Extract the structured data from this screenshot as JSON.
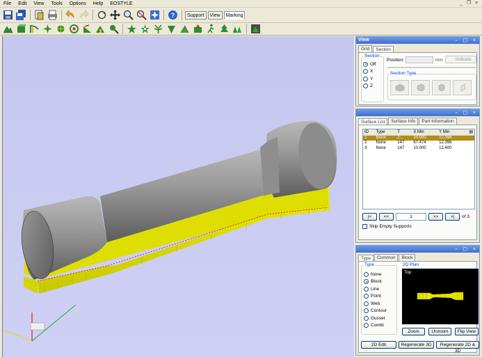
{
  "menu": [
    "File",
    "Edit",
    "View",
    "Tools",
    "Options",
    "Help",
    "EOSTYLE"
  ],
  "toolbar_tabs": [
    {
      "label": "Support",
      "active": false
    },
    {
      "label": "View",
      "active": false
    },
    {
      "label": "Marking",
      "active": true
    }
  ],
  "view_panel": {
    "title": "View",
    "tabs": [
      {
        "label": "Grid",
        "active": false
      },
      {
        "label": "Section",
        "active": true
      }
    ],
    "section_group_label": "Section",
    "section_options": [
      {
        "label": "Off",
        "checked": true
      },
      {
        "label": "X",
        "checked": false
      },
      {
        "label": "Y",
        "checked": false
      },
      {
        "label": "Z",
        "checked": false
      }
    ],
    "position_label": "Position:",
    "position_value": "",
    "unit": "mm",
    "indicate_label": "Indicate",
    "section_type_label": "Section Type"
  },
  "surface_panel": {
    "tabs": [
      {
        "label": "Surface List",
        "active": true
      },
      {
        "label": "Surface Info",
        "active": false
      },
      {
        "label": "Part Information",
        "active": false
      }
    ],
    "columns": [
      "ID",
      "Type",
      "T",
      "X Min",
      "Y Min"
    ],
    "rows": [
      {
        "id": "1",
        "type": "Block",
        "t": "2...",
        "xmin": "10.000",
        "ymin": "12.398",
        "selected": true
      },
      {
        "id": "2",
        "type": "None",
        "t": "147",
        "xmin": "67.474",
        "ymin": "12.398",
        "selected": false
      },
      {
        "id": "3",
        "type": "None",
        "t": "147",
        "xmin": "10.000",
        "ymin": "12.400",
        "selected": false
      }
    ],
    "nav": {
      "first": "|<",
      "prev": "<<",
      "page": "1",
      "next": ">>",
      "last": ">|",
      "of_total": "of 3"
    },
    "skip_label": "Skip Empty Supports"
  },
  "type_panel": {
    "tabs": [
      {
        "label": "Type",
        "active": true
      },
      {
        "label": "Common",
        "active": false
      },
      {
        "label": "Block",
        "active": false
      }
    ],
    "type_group_label": "Type",
    "types": [
      {
        "label": "None",
        "checked": false
      },
      {
        "label": "Block",
        "checked": true
      },
      {
        "label": "Line",
        "checked": false
      },
      {
        "label": "Point",
        "checked": false
      },
      {
        "label": "Web",
        "checked": false
      },
      {
        "label": "Contour",
        "checked": false
      },
      {
        "label": "Gusset",
        "checked": false
      },
      {
        "label": "Combi",
        "checked": false
      }
    ],
    "plan_label": "2D Plan",
    "plan_view_label": "Top",
    "zoom_label": "Zoom",
    "unzoom_label": "Unzoom",
    "flip_label": "Flip View",
    "edit2d_label": "2D Edit",
    "regen3d_label": "Regenerate 3D",
    "regen2d3d_label": "Regenerate 2D & 3D"
  },
  "colors": {
    "viewport_bg": "#c6c7ef",
    "support_yellow": "#f2f200",
    "part_gray": "#8a8a8a",
    "panel_title": "#3f6fcf",
    "selected_row": "#b18d19"
  }
}
